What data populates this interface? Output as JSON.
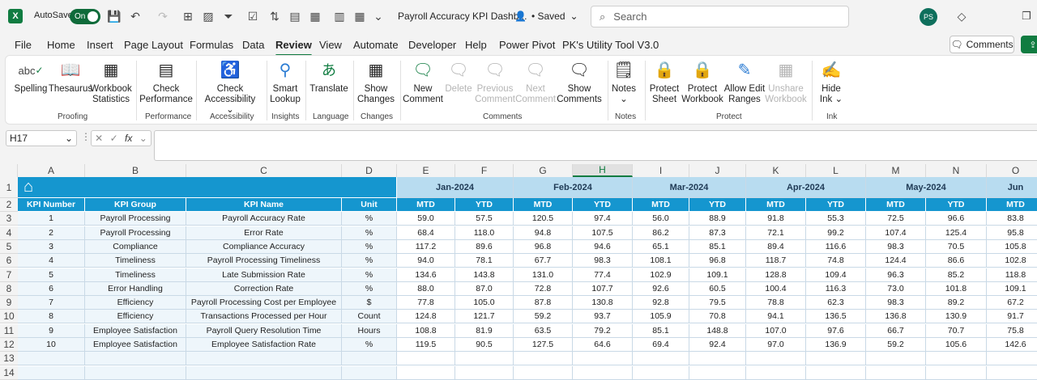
{
  "app": {
    "autosave_label": "AutoSave",
    "autosave_state": "On",
    "doc_title": "Payroll Accuracy KPI Dashb...",
    "saved_status": "• Saved",
    "search_placeholder": "Search",
    "avatar_initials": "PS",
    "accent_color": "#107c41"
  },
  "menu": [
    "File",
    "Home",
    "Insert",
    "Page Layout",
    "Formulas",
    "Data",
    "Review",
    "View",
    "Automate",
    "Developer",
    "Help",
    "Power Pivot",
    "PK's Utility Tool V3.0"
  ],
  "active_menu": "Review",
  "comments_button": "Comments",
  "ribbon": {
    "buttons": [
      {
        "id": "spelling",
        "label": "Spelling",
        "icon": "abc-check-icon"
      },
      {
        "id": "thesaurus",
        "label": "Thesaurus",
        "icon": "book-icon"
      },
      {
        "id": "workbook-statistics",
        "label": "Workbook\nStatistics",
        "icon": "statistics-icon"
      },
      {
        "id": "check-performance",
        "label": "Check\nPerformance",
        "icon": "performance-icon"
      },
      {
        "id": "check-accessibility",
        "label": "Check\nAccessibility ⌄",
        "icon": "accessibility-icon"
      },
      {
        "id": "smart-lookup",
        "label": "Smart\nLookup",
        "icon": "lookup-icon"
      },
      {
        "id": "translate",
        "label": "Translate",
        "icon": "translate-icon"
      },
      {
        "id": "show-changes",
        "label": "Show\nChanges",
        "icon": "changes-icon"
      },
      {
        "id": "new-comment",
        "label": "New\nComment",
        "icon": "new-comment-icon"
      },
      {
        "id": "delete",
        "label": "Delete",
        "icon": "delete-comment-icon"
      },
      {
        "id": "previous-comment",
        "label": "Previous\nComment",
        "icon": "previous-comment-icon"
      },
      {
        "id": "next-comment",
        "label": "Next\nComment",
        "icon": "next-comment-icon"
      },
      {
        "id": "show-comments",
        "label": "Show\nComments",
        "icon": "comments-icon"
      },
      {
        "id": "notes",
        "label": "Notes\n⌄",
        "icon": "notes-icon"
      },
      {
        "id": "protect-sheet",
        "label": "Protect\nSheet",
        "icon": "protect-sheet-icon"
      },
      {
        "id": "protect-workbook",
        "label": "Protect\nWorkbook",
        "icon": "protect-workbook-icon"
      },
      {
        "id": "allow-edit-ranges",
        "label": "Allow Edit\nRanges",
        "icon": "edit-ranges-icon"
      },
      {
        "id": "unshare-workbook",
        "label": "Unshare\nWorkbook",
        "icon": "unshare-icon"
      },
      {
        "id": "hide-ink",
        "label": "Hide\nInk ⌄",
        "icon": "ink-icon"
      }
    ],
    "groups": [
      "Proofing",
      "Performance",
      "Accessibility",
      "Insights",
      "Language",
      "Changes",
      "Comments",
      "Notes",
      "Protect",
      "Ink"
    ]
  },
  "name_box": "H17",
  "fx_label": "fx",
  "columns": [
    "A",
    "B",
    "C",
    "D",
    "E",
    "F",
    "G",
    "H",
    "I",
    "J",
    "K",
    "L",
    "M",
    "N",
    "O"
  ],
  "rows": [
    "1",
    "2",
    "3",
    "4",
    "5",
    "6",
    "7",
    "8",
    "9",
    "10",
    "11",
    "12",
    "13",
    "14"
  ],
  "table": {
    "headers": [
      "KPI Number",
      "KPI Group",
      "KPI Name",
      "Unit"
    ],
    "months": [
      "Jan-2024",
      "Feb-2024",
      "Mar-2024",
      "Apr-2024",
      "May-2024",
      "Jun"
    ],
    "sub_headers": [
      "MTD",
      "YTD",
      "MTD",
      "YTD",
      "MTD",
      "YTD",
      "MTD",
      "YTD",
      "MTD",
      "YTD",
      "MTD"
    ],
    "rows": [
      [
        "1",
        "Payroll Processing",
        "Payroll Accuracy Rate",
        "%",
        "59.0",
        "57.5",
        "120.5",
        "97.4",
        "56.0",
        "88.9",
        "91.8",
        "55.3",
        "72.5",
        "96.6",
        "83.8"
      ],
      [
        "2",
        "Payroll Processing",
        "Error Rate",
        "%",
        "68.4",
        "118.0",
        "94.8",
        "107.5",
        "86.2",
        "87.3",
        "72.1",
        "99.2",
        "107.4",
        "125.4",
        "95.8"
      ],
      [
        "3",
        "Compliance",
        "Compliance Accuracy",
        "%",
        "117.2",
        "89.6",
        "96.8",
        "94.6",
        "65.1",
        "85.1",
        "89.4",
        "116.6",
        "98.3",
        "70.5",
        "105.8"
      ],
      [
        "4",
        "Timeliness",
        "Payroll Processing Timeliness",
        "%",
        "94.0",
        "78.1",
        "67.7",
        "98.3",
        "108.1",
        "96.8",
        "118.7",
        "74.8",
        "124.4",
        "86.6",
        "102.8"
      ],
      [
        "5",
        "Timeliness",
        "Late Submission Rate",
        "%",
        "134.6",
        "143.8",
        "131.0",
        "77.4",
        "102.9",
        "109.1",
        "128.8",
        "109.4",
        "96.3",
        "85.2",
        "118.8"
      ],
      [
        "6",
        "Error Handling",
        "Correction Rate",
        "%",
        "88.0",
        "87.0",
        "72.8",
        "107.7",
        "92.6",
        "60.5",
        "100.4",
        "116.3",
        "73.0",
        "101.8",
        "109.1"
      ],
      [
        "7",
        "Efficiency",
        "Payroll Processing Cost per Employee",
        "$",
        "77.8",
        "105.0",
        "87.8",
        "130.8",
        "92.8",
        "79.5",
        "78.8",
        "62.3",
        "98.3",
        "89.2",
        "67.2"
      ],
      [
        "8",
        "Efficiency",
        "Transactions Processed per Hour",
        "Count",
        "124.8",
        "121.7",
        "59.2",
        "93.7",
        "105.9",
        "70.8",
        "94.1",
        "136.5",
        "136.8",
        "130.9",
        "91.7"
      ],
      [
        "9",
        "Employee Satisfaction",
        "Payroll Query Resolution Time",
        "Hours",
        "108.8",
        "81.9",
        "63.5",
        "79.2",
        "85.1",
        "148.8",
        "107.0",
        "97.6",
        "66.7",
        "70.7",
        "75.8"
      ],
      [
        "10",
        "Employee Satisfaction",
        "Employee Satisfaction Rate",
        "%",
        "119.5",
        "90.5",
        "127.5",
        "64.6",
        "69.4",
        "92.4",
        "97.0",
        "136.9",
        "59.2",
        "105.6",
        "142.6"
      ]
    ]
  }
}
